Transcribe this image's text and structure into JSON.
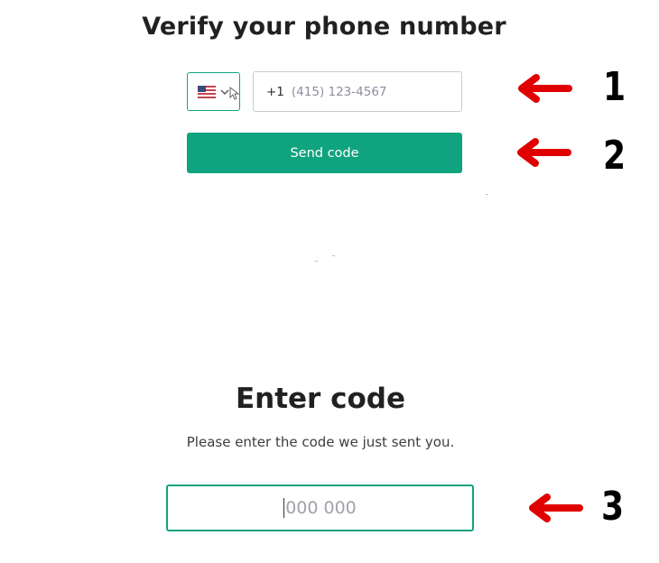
{
  "phone_section": {
    "title": "Verify your phone number",
    "country_icon": "us-flag-icon",
    "phone_prefix": "+1",
    "phone_placeholder": "(415) 123-4567",
    "send_button_label": "Send code"
  },
  "code_section": {
    "title": "Enter code",
    "subtitle": "Please enter the code we just sent you.",
    "code_placeholder": "000 000"
  },
  "annotations": {
    "markers": [
      "1",
      "2",
      "3"
    ],
    "arrow_color": "#e00000"
  },
  "colors": {
    "accent": "#10a37f"
  }
}
